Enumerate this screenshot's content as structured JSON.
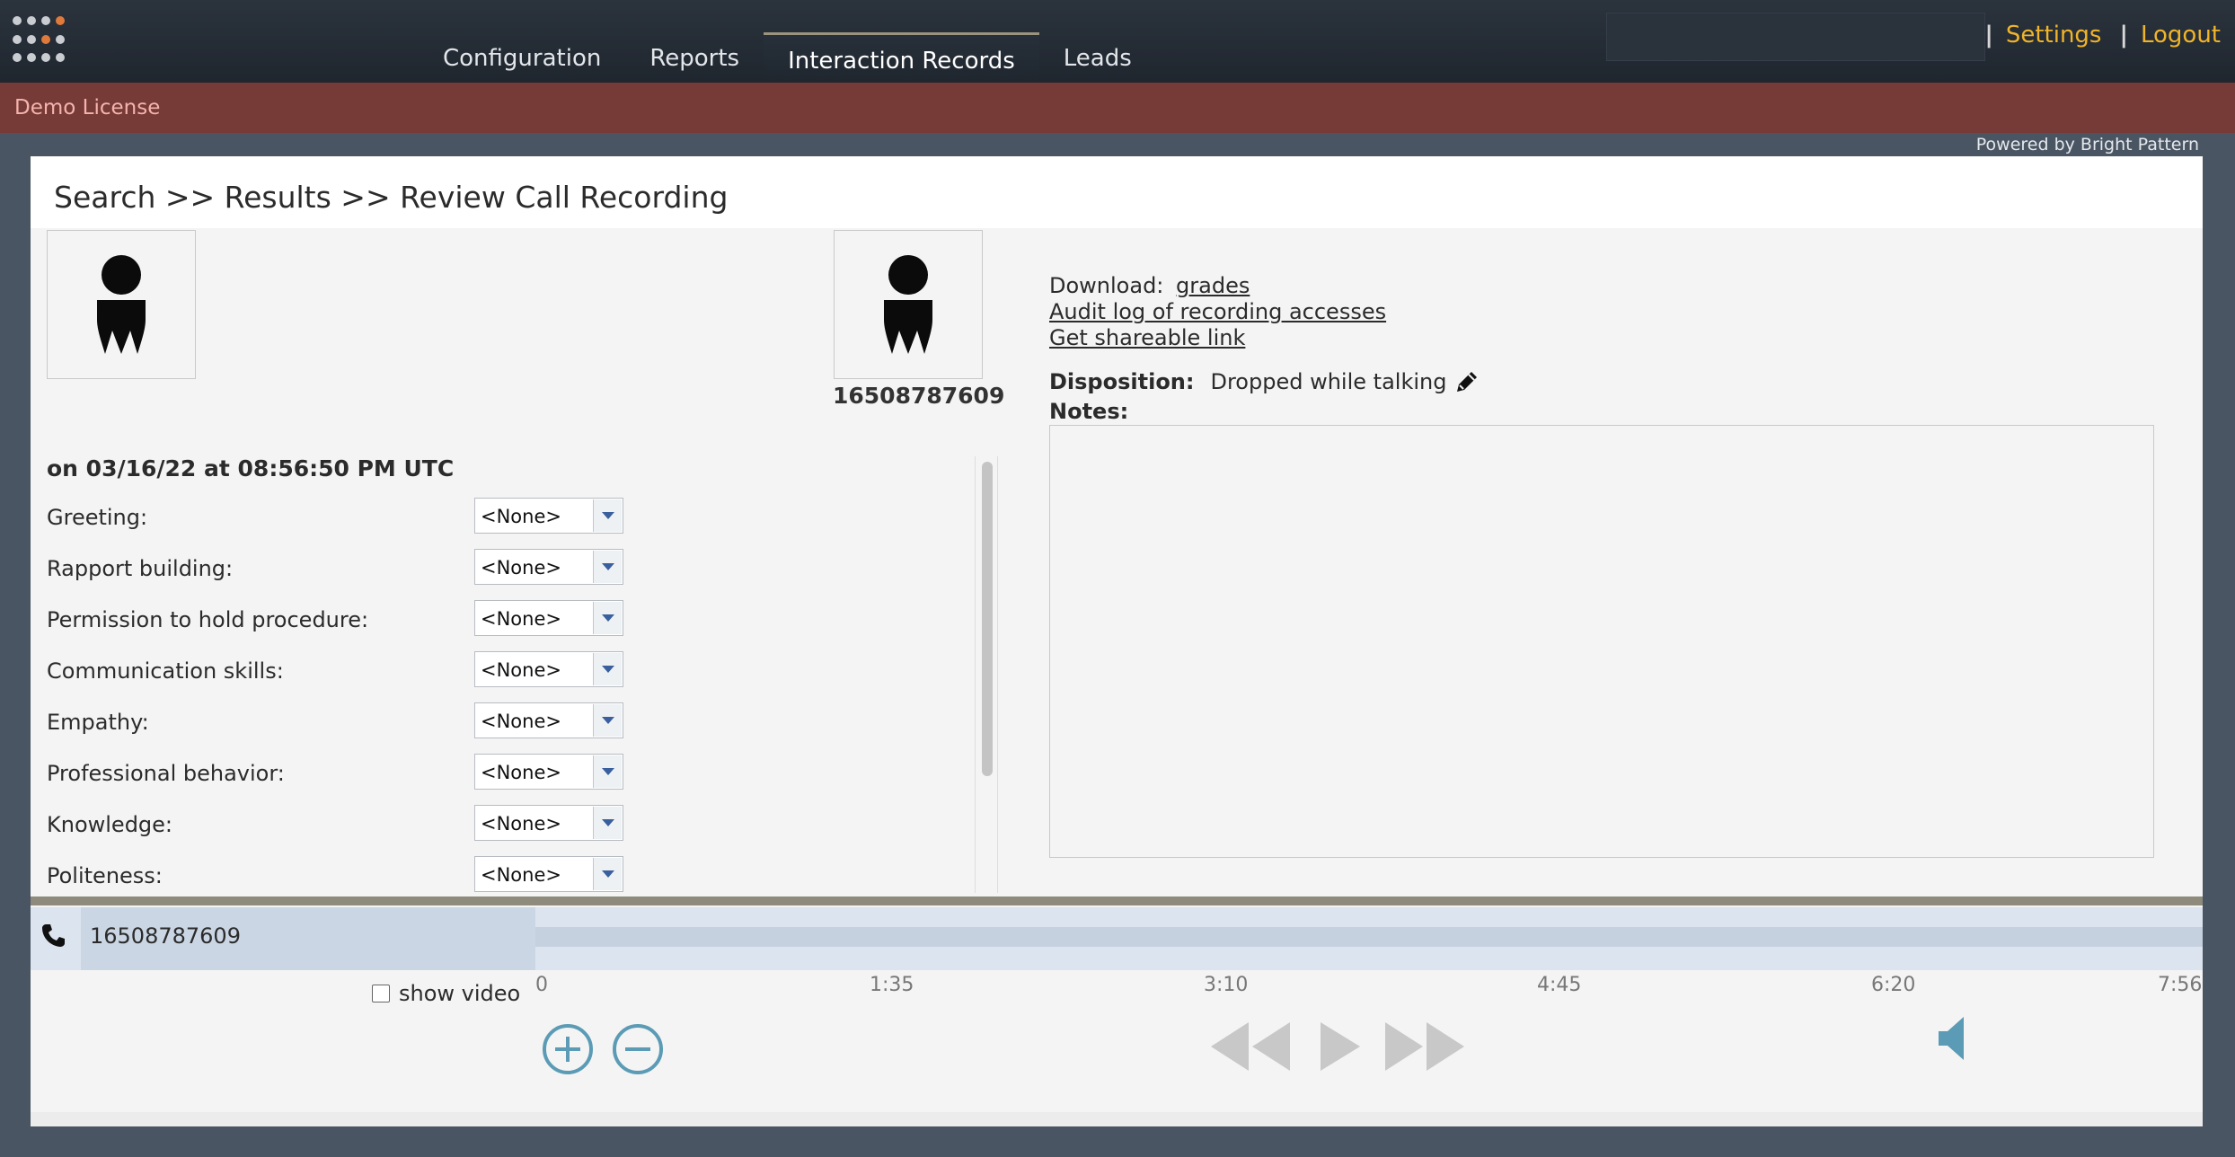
{
  "nav": {
    "items": [
      "Configuration",
      "Reports",
      "Interaction Records",
      "Leads"
    ],
    "active": "Interaction Records"
  },
  "toplinks": {
    "settings": "Settings",
    "logout": "Logout",
    "separator": "|"
  },
  "license": "Demo License",
  "powered_by": "Powered by Bright Pattern",
  "page_title": "Search >> Results >> Review Call Recording",
  "caller_number": "16508787609",
  "recording_date": "on 03/16/22 at 08:56:50 PM UTC",
  "grades": [
    {
      "label": "Greeting:",
      "value": "<None>"
    },
    {
      "label": "Rapport building:",
      "value": "<None>"
    },
    {
      "label": "Permission to hold procedure:",
      "value": "<None>"
    },
    {
      "label": "Communication skills:",
      "value": "<None>"
    },
    {
      "label": "Empathy:",
      "value": "<None>"
    },
    {
      "label": "Professional behavior:",
      "value": "<None>"
    },
    {
      "label": "Knowledge:",
      "value": "<None>"
    },
    {
      "label": "Politeness:",
      "value": "<None>"
    }
  ],
  "download": {
    "label": "Download:",
    "grades_link": "grades",
    "audit_link": "Audit log of recording accesses",
    "share_link": "Get shareable link"
  },
  "disposition": {
    "label": "Disposition:",
    "value": "Dropped while talking"
  },
  "notes": {
    "label": "Notes:",
    "value": ""
  },
  "player": {
    "track_label": "16508787609",
    "ticks": [
      "0",
      "1:35",
      "3:10",
      "4:45",
      "6:20",
      "7:56"
    ],
    "show_video": "show video",
    "show_video_checked": false
  },
  "colors": {
    "accent_link": "#f0b429",
    "license_bar": "#763b37",
    "player_icon": "#5b9bb5"
  }
}
